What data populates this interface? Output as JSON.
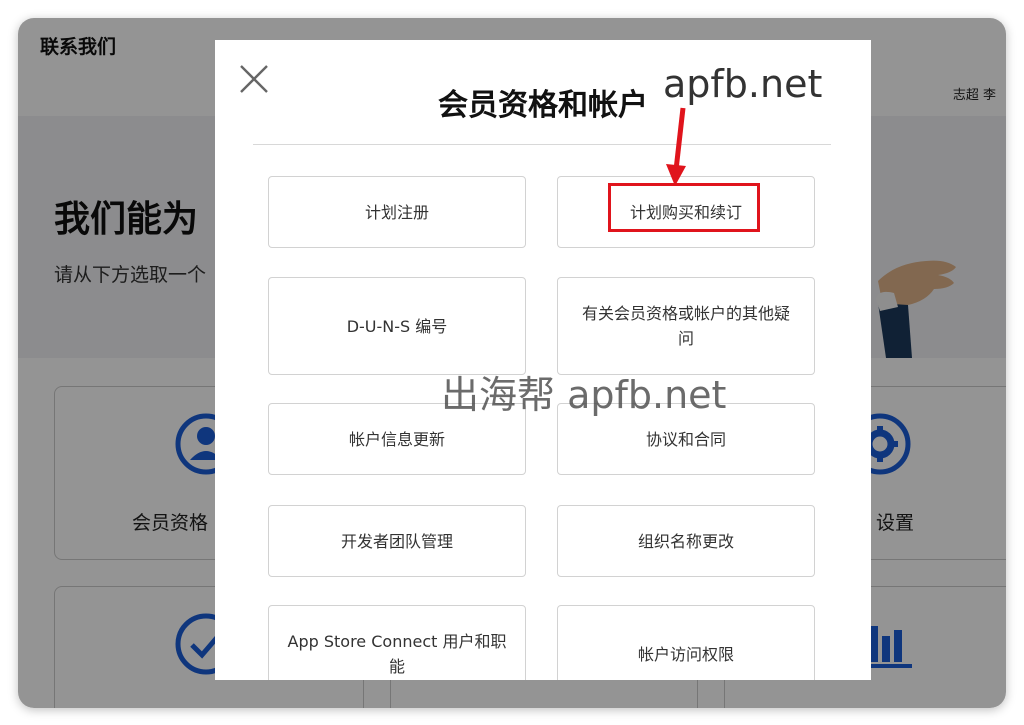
{
  "header": {
    "title": "联系我们",
    "user_name": "志超 李"
  },
  "hero": {
    "title": "我们能为",
    "subtitle": "请从下方选取一个"
  },
  "categories": [
    {
      "label": "会员资格",
      "icon": "person-icon"
    },
    {
      "label": "设置",
      "icon": "gear-icon"
    },
    {
      "label": "",
      "icon": "checkmark-icon"
    },
    {
      "label": "",
      "icon": "bar-chart-icon"
    }
  ],
  "modal": {
    "title": "会员资格和帐户",
    "options": [
      "计划注册",
      "计划购买和续订",
      "D-U-N-S 编号",
      "有关会员资格或帐户的其他疑问",
      "帐户信息更新",
      "协议和合同",
      "开发者团队管理",
      "组织名称更改",
      "App Store Connect 用户和职能",
      "帐户访问权限"
    ]
  },
  "watermarks": {
    "top": "apfb.net",
    "center": "出海帮 apfb.net"
  },
  "colors": {
    "accent": "#1b5dd8",
    "highlight": "#e0141c",
    "overlay": "rgba(0,0,0,0.42)"
  }
}
